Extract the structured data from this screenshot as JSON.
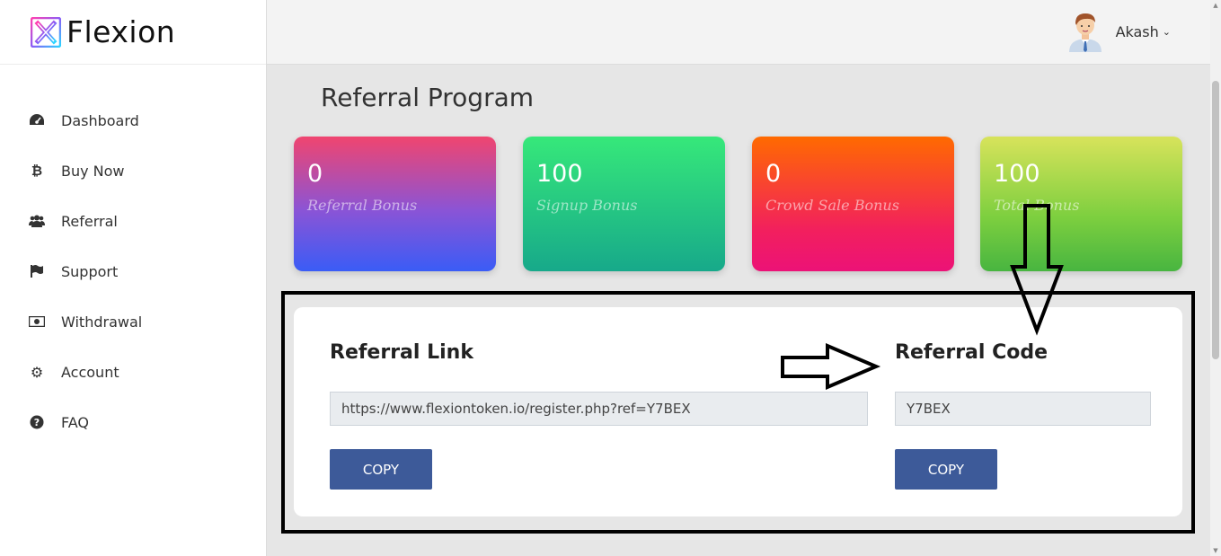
{
  "brand": {
    "name": "Flexion",
    "logo_icon": "flexion-x-logo"
  },
  "sidebar": {
    "items": [
      {
        "label": "Dashboard",
        "icon": "dashboard-icon"
      },
      {
        "label": "Buy Now",
        "icon": "bitcoin-icon"
      },
      {
        "label": "Referral",
        "icon": "users-icon"
      },
      {
        "label": "Support",
        "icon": "flag-icon"
      },
      {
        "label": "Withdrawal",
        "icon": "money-icon"
      },
      {
        "label": "Account",
        "icon": "gear-icon"
      },
      {
        "label": "FAQ",
        "icon": "question-icon"
      }
    ]
  },
  "header": {
    "user_name": "Akash",
    "caret": "⌄"
  },
  "page": {
    "title": "Referral Program"
  },
  "cards": [
    {
      "value": "0",
      "label": "Referral Bonus"
    },
    {
      "value": "100",
      "label": "Signup Bonus"
    },
    {
      "value": "0",
      "label": "Crowd Sale Bonus"
    },
    {
      "value": "100",
      "label": "Total Bonus"
    }
  ],
  "referral_link": {
    "title": "Referral Link",
    "value": "https://www.flexiontoken.io/register.php?ref=Y7BEX",
    "button": "COPY"
  },
  "referral_code": {
    "title": "Referral Code",
    "value": "Y7BEX",
    "button": "COPY"
  },
  "colors": {
    "accent_button": "#3d5a99",
    "sidebar_bg": "#ffffff",
    "content_bg": "#e6e6e6"
  }
}
